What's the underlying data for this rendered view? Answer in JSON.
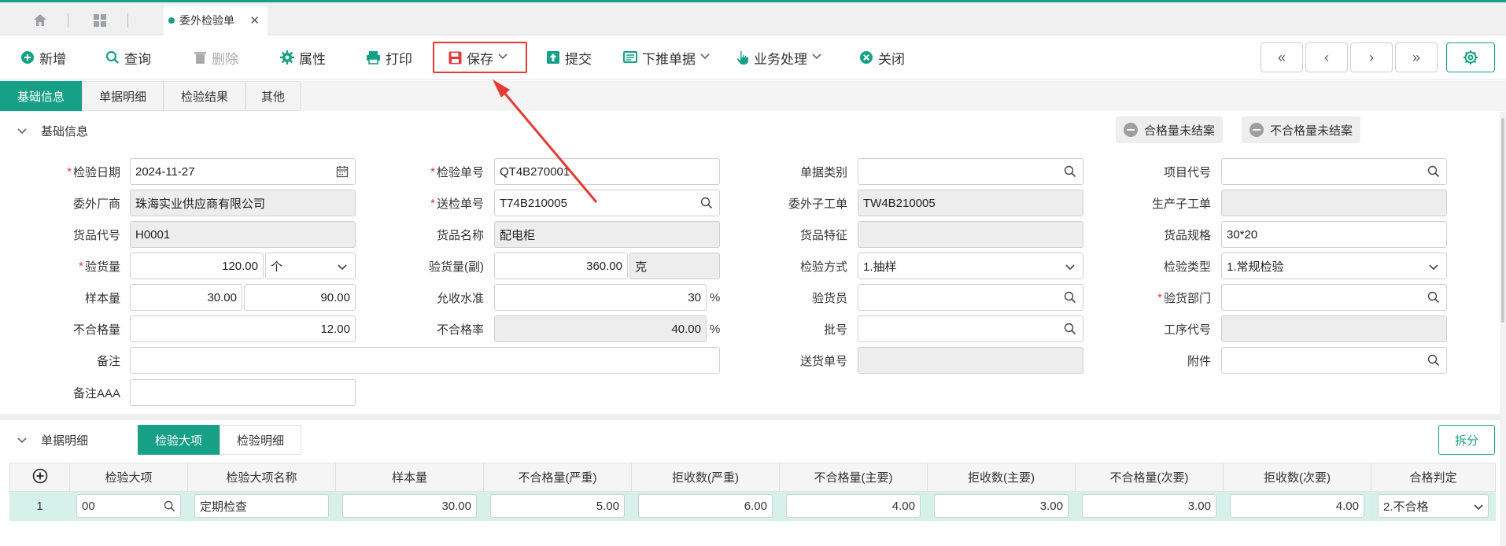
{
  "tabbar": {
    "home_icon": "home-icon",
    "apps_icon": "grid-icon",
    "doc_tab_label": "委外检验单",
    "close_glyph": "✕"
  },
  "toolbar": {
    "add": "新增",
    "query": "查询",
    "delete": "删除",
    "props": "属性",
    "print": "打印",
    "save": "保存",
    "submit": "提交",
    "push_down": "下推单据",
    "business": "业务处理",
    "close": "关闭",
    "nav_first": "«",
    "nav_prev": "‹",
    "nav_next": "›",
    "nav_last": "»"
  },
  "subtabs": [
    "基础信息",
    "单据明细",
    "检验结果",
    "其他"
  ],
  "basic": {
    "title": "基础信息",
    "tag_qualified": "合格量未结案",
    "tag_unqualified": "不合格量未结案",
    "labels": {
      "inspect_date": "检验日期",
      "inspect_no": "检验单号",
      "doc_category": "单据类别",
      "project_code": "项目代号",
      "vendor": "委外厂商",
      "send_no": "送检单号",
      "sub_work_order": "委外子工单",
      "prod_sub_order": "生产子工单",
      "item_code": "货品代号",
      "item_name": "货品名称",
      "item_feature": "货品特征",
      "item_spec": "货品规格",
      "qty": "验货量",
      "qty_sub": "验货量(副)",
      "method": "检验方式",
      "type": "检验类型",
      "sample_qty": "样本量",
      "accept_level": "允收水准",
      "inspector": "验货员",
      "dept": "验货部门",
      "defect_qty": "不合格量",
      "defect_rate": "不合格率",
      "batch_no": "批号",
      "process_code": "工序代号",
      "remark": "备注",
      "delivery_no": "送货单号",
      "attachment": "附件",
      "remark_aaa": "备注AAA"
    },
    "values": {
      "inspect_date": "2024-11-27",
      "inspect_no": "QT4B270001",
      "vendor": "珠海实业供应商有限公司",
      "send_no": "T74B210005",
      "sub_work_order": "TW4B210005",
      "item_code": "H0001",
      "item_name": "配电柜",
      "item_spec": "30*20",
      "qty": "120.00",
      "qty_unit": "个",
      "qty_sub": "360.00",
      "qty_sub_unit": "克",
      "method": "1.抽样",
      "type": "1.常规检验",
      "sample_qty_1": "30.00",
      "sample_qty_2": "90.00",
      "accept_level": "30",
      "defect_qty": "12.00",
      "defect_rate": "40.00",
      "pct": "%"
    }
  },
  "detail": {
    "title": "单据明细",
    "toggle_major": "检验大项",
    "toggle_detail": "检验明细",
    "split": "拆分",
    "columns": [
      "检验大项",
      "检验大项名称",
      "样本量",
      "不合格量(严重)",
      "拒收数(严重)",
      "不合格量(主要)",
      "拒收数(主要)",
      "不合格量(次要)",
      "拒收数(次要)",
      "合格判定"
    ],
    "rows": [
      {
        "no": "1",
        "major": "00",
        "name": "定期检查",
        "sample": "30.00",
        "defect_severe": "5.00",
        "reject_severe": "6.00",
        "defect_main": "4.00",
        "reject_main": "3.00",
        "defect_minor": "3.00",
        "reject_minor": "4.00",
        "verdict": "2.不合格"
      }
    ]
  },
  "colors": {
    "accent": "#16a085",
    "highlight_red": "#e53935"
  }
}
